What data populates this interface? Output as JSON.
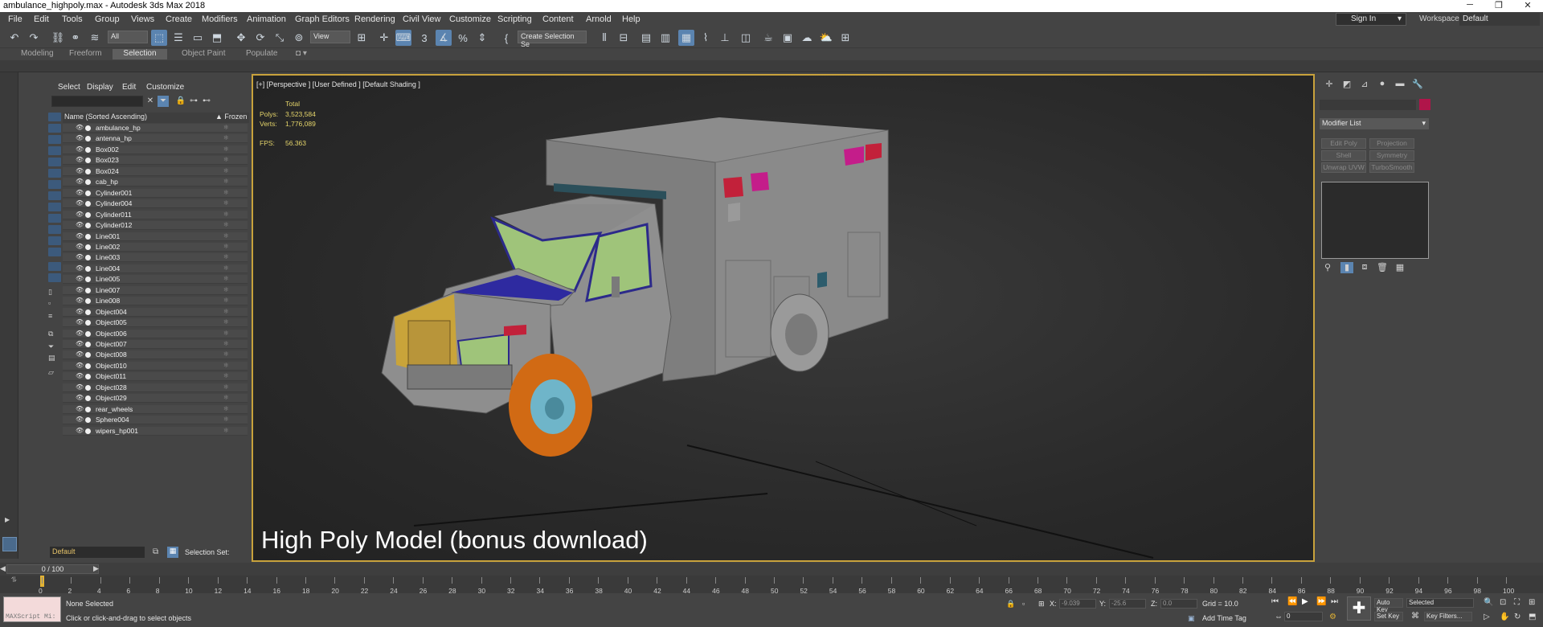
{
  "window": {
    "title": "ambulance_highpoly.max - Autodesk 3ds Max 2018",
    "controls": [
      "─",
      "❐",
      "✕"
    ]
  },
  "menu": [
    "File",
    "Edit",
    "Tools",
    "Group",
    "Views",
    "Create",
    "Modifiers",
    "Animation",
    "Graph Editors",
    "Rendering",
    "Civil View",
    "Customize",
    "Scripting",
    "Content",
    "Arnold",
    "Help"
  ],
  "account": {
    "sign_in": "Sign In",
    "workspaces_label": "Workspaces:",
    "workspace": "Default"
  },
  "toolbar": {
    "filter": "All",
    "ref_coord": "View",
    "selection_set": "Create Selection Se"
  },
  "ribbon_tabs": [
    "Modeling",
    "Freeform",
    "Selection",
    "Object Paint",
    "Populate"
  ],
  "ribbon_active": "Selection",
  "scene_explorer": {
    "menu": [
      "Select",
      "Display",
      "Edit",
      "Customize"
    ],
    "col_name": "Name (Sorted Ascending)",
    "col_frozen": "▲ Frozen",
    "items": [
      "ambulance_hp",
      "antenna_hp",
      "Box002",
      "Box023",
      "Box024",
      "cab_hp",
      "Cylinder001",
      "Cylinder004",
      "Cylinder011",
      "Cylinder012",
      "Line001",
      "Line002",
      "Line003",
      "Line004",
      "Line005",
      "Line007",
      "Line008",
      "Object004",
      "Object005",
      "Object006",
      "Object007",
      "Object008",
      "Object010",
      "Object011",
      "Object028",
      "Object029",
      "rear_wheels",
      "Sphere004",
      "wipers_hp001"
    ],
    "layer": "Default",
    "selection_set_label": "Selection Set:"
  },
  "viewport": {
    "label": "[+] [Perspective ] [User Defined ] [Default Shading ]",
    "stats": {
      "total": "Total",
      "polys_label": "Polys:",
      "polys": "3,523,584",
      "verts_label": "Verts:",
      "verts": "1,776,089",
      "fps_label": "FPS:",
      "fps": "56.363"
    },
    "watermark": "High Poly Model (bonus download)"
  },
  "command_panel": {
    "modifier_list": "Modifier List",
    "buttons": [
      "Edit Poly",
      "Projection",
      "Shell",
      "Symmetry",
      "Unwrap UVW",
      "TurboSmooth"
    ],
    "object_color": "#b0154a"
  },
  "timeline": {
    "frame_box": "0 / 100",
    "ticks": [
      "0",
      "2",
      "4",
      "6",
      "8",
      "10",
      "12",
      "14",
      "16",
      "18",
      "20",
      "22",
      "24",
      "26",
      "28",
      "30",
      "32",
      "34",
      "36",
      "38",
      "40",
      "42",
      "44",
      "46",
      "48",
      "50",
      "52",
      "54",
      "56",
      "58",
      "60",
      "62",
      "64",
      "66",
      "68",
      "70",
      "72",
      "74",
      "76",
      "78",
      "80",
      "82",
      "84",
      "86",
      "88",
      "90",
      "92",
      "94",
      "96",
      "98",
      "100"
    ]
  },
  "status": {
    "maxscript": "MAXScript Mi:",
    "selected": "None Selected",
    "prompt": "Click or click-and-drag to select objects",
    "x_label": "X:",
    "x": "-9.039",
    "y_label": "Y:",
    "y": "-25.6",
    "z_label": "Z:",
    "z": "0.0",
    "grid": "Grid = 10.0",
    "add_time_tag": "Add Time Tag",
    "auto_key": "Auto Key",
    "set_key": "Set Key",
    "key_mode": "Selected",
    "key_filters": "Key Filters...",
    "frame": "0"
  }
}
